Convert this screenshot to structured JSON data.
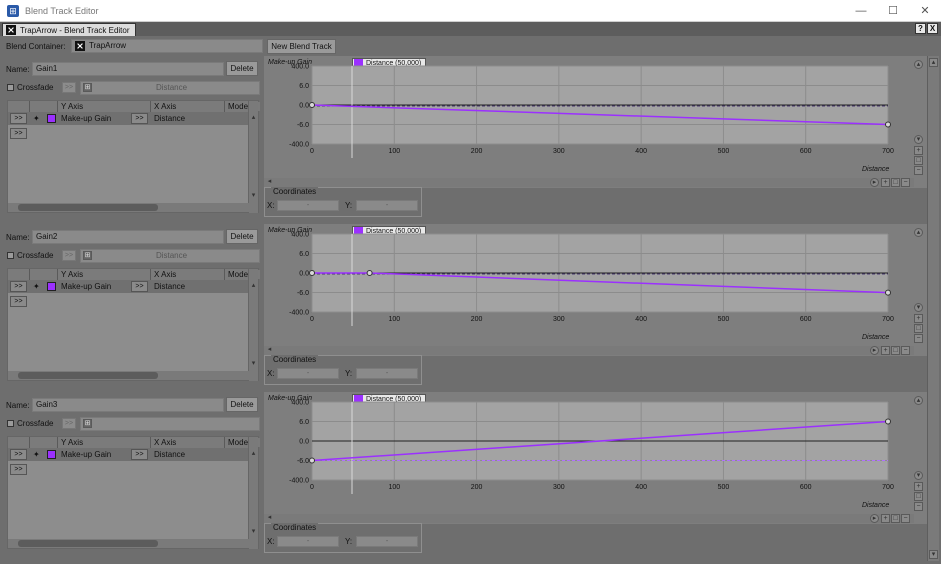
{
  "window": {
    "title": "Blend Track Editor",
    "minimize": "—",
    "maximize": "☐",
    "close": "✕"
  },
  "tab": {
    "label": "TrapArrow - Blend Track Editor",
    "help": "?",
    "close": "X"
  },
  "toolbar": {
    "blend_container_label": "Blend Container:",
    "blend_container_value": "TrapArrow",
    "new_blend_track_label": "New Blend Track"
  },
  "tracks": [
    {
      "name_label": "Name:",
      "name_value": "Gain1",
      "delete_label": "Delete",
      "crossfade_label": "Crossfade",
      "crossfade_param": "Distance",
      "columns": [
        "Y Axis",
        "X Axis",
        "Mode"
      ],
      "row": {
        "y_axis": "Make-up Gain",
        "x_axis": "Distance"
      },
      "expand_label": ">>",
      "legend": "Distance (50,000)",
      "ylabel": "Make-up Gain",
      "xlabel": "Distance",
      "yticks": [
        "400.0",
        "6.0",
        "0.0",
        "-6.0",
        "-400.0"
      ],
      "xticks": [
        "0",
        "100",
        "200",
        "300",
        "400",
        "500",
        "600",
        "700"
      ],
      "coordinates_label": "Coordinates",
      "x_label": "X:",
      "y_label": "Y:",
      "x_value": "-",
      "y_value": "-"
    },
    {
      "name_label": "Name:",
      "name_value": "Gain2",
      "delete_label": "Delete",
      "crossfade_label": "Crossfade",
      "crossfade_param": "Distance",
      "columns": [
        "Y Axis",
        "X Axis",
        "Mode"
      ],
      "row": {
        "y_axis": "Make-up Gain",
        "x_axis": "Distance"
      },
      "expand_label": ">>",
      "legend": "Distance (50,000)",
      "ylabel": "Make-up Gain",
      "xlabel": "Distance",
      "yticks": [
        "400.0",
        "6.0",
        "0.0",
        "-6.0",
        "-400.0"
      ],
      "xticks": [
        "0",
        "100",
        "200",
        "300",
        "400",
        "500",
        "600",
        "700"
      ],
      "coordinates_label": "Coordinates",
      "x_label": "X:",
      "y_label": "Y:",
      "x_value": "-",
      "y_value": "-"
    },
    {
      "name_label": "Name:",
      "name_value": "Gain3",
      "delete_label": "Delete",
      "crossfade_label": "Crossfade",
      "crossfade_param": "",
      "columns": [
        "Y Axis",
        "X Axis",
        "Mode"
      ],
      "row": {
        "y_axis": "Make-up Gain",
        "x_axis": "Distance"
      },
      "expand_label": ">>",
      "legend": "Distance (50,000)",
      "ylabel": "Make-up Gain",
      "xlabel": "Distance",
      "yticks": [
        "400.0",
        "6.0",
        "0.0",
        "-6.0",
        "-400.0"
      ],
      "xticks": [
        "0",
        "100",
        "200",
        "300",
        "400",
        "500",
        "600",
        "700"
      ],
      "coordinates_label": "Coordinates",
      "x_label": "X:",
      "y_label": "Y:",
      "x_value": "-",
      "y_value": "-"
    }
  ],
  "colors": {
    "curve": "#9b30ff",
    "graph_bg": "#a3a3a3",
    "panel_bg": "#6e6e6e"
  },
  "chart_data": [
    {
      "type": "line",
      "x": [
        0,
        700
      ],
      "y": [
        0.0,
        -6.0
      ],
      "xlim": [
        0,
        700
      ],
      "xlabel": "Distance",
      "ylabel": "Make-up Gain"
    },
    {
      "type": "line",
      "x": [
        0,
        70,
        700
      ],
      "y": [
        0.0,
        0.0,
        -9.0
      ],
      "xlim": [
        0,
        700
      ],
      "xlabel": "Distance",
      "ylabel": "Make-up Gain"
    },
    {
      "type": "line",
      "x": [
        0,
        700
      ],
      "y": [
        -6.0,
        6.0
      ],
      "xlim": [
        0,
        700
      ],
      "xlabel": "Distance",
      "ylabel": "Make-up Gain"
    }
  ]
}
